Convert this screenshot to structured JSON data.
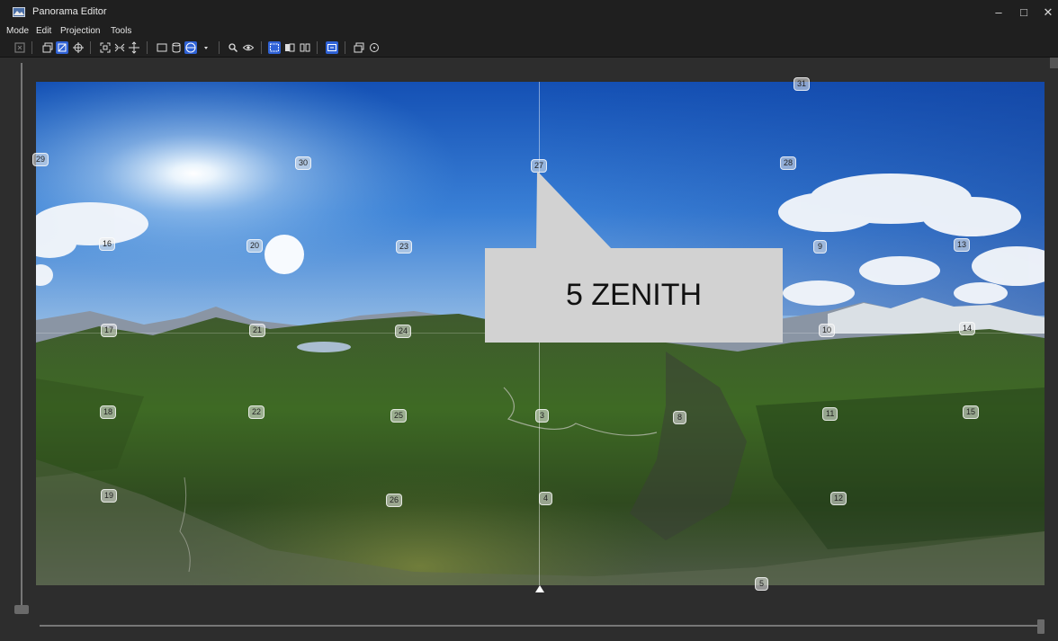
{
  "window": {
    "title": "Panorama Editor",
    "minimize": "–",
    "maximize": "□",
    "close": "✕"
  },
  "menu": [
    "Mode",
    "Edit",
    "Projection",
    "Tools"
  ],
  "toolbar": [
    {
      "name": "preview-icon",
      "active": false
    },
    {
      "name": "panorama-mode-icon",
      "active": false
    },
    {
      "name": "layout-mode-icon",
      "active": true
    },
    {
      "name": "move-icon",
      "active": false
    },
    {
      "name": "fit-icon",
      "active": false
    },
    {
      "name": "straighten-icon",
      "active": false
    },
    {
      "name": "center-icon",
      "active": false
    },
    {
      "name": "rectilinear-icon",
      "active": false
    },
    {
      "name": "cylindrical-icon",
      "active": false
    },
    {
      "name": "equirectangular-icon",
      "active": true
    },
    {
      "name": "projection-dropdown-icon",
      "active": false
    },
    {
      "name": "zoom-icon",
      "active": false
    },
    {
      "name": "eye-icon",
      "active": false
    },
    {
      "name": "crop-icon",
      "active": true
    },
    {
      "name": "identify-icon",
      "active": false
    },
    {
      "name": "book-icon",
      "active": false
    },
    {
      "name": "control-points-icon",
      "active": true
    },
    {
      "name": "overlay-icon",
      "active": false
    },
    {
      "name": "help-icon",
      "active": false
    }
  ],
  "control_points": [
    {
      "label": "31"
    },
    {
      "label": "29"
    },
    {
      "label": "30"
    },
    {
      "label": "27"
    },
    {
      "label": "28"
    },
    {
      "label": "16"
    },
    {
      "label": "20"
    },
    {
      "label": "23"
    },
    {
      "label": "9"
    },
    {
      "label": "13"
    },
    {
      "label": "17"
    },
    {
      "label": "21"
    },
    {
      "label": "24"
    },
    {
      "label": "10"
    },
    {
      "label": "14"
    },
    {
      "label": "18"
    },
    {
      "label": "22"
    },
    {
      "label": "25"
    },
    {
      "label": "3"
    },
    {
      "label": "8"
    },
    {
      "label": "11"
    },
    {
      "label": "15"
    },
    {
      "label": "19"
    },
    {
      "label": "26"
    },
    {
      "label": "4"
    },
    {
      "label": "12"
    },
    {
      "label": "5"
    }
  ],
  "callout": {
    "text": "5 ZENITH"
  },
  "colors": {
    "chrome": "#1f1f1f",
    "accent": "#2f62d6",
    "callout": "#d2d2d2"
  }
}
